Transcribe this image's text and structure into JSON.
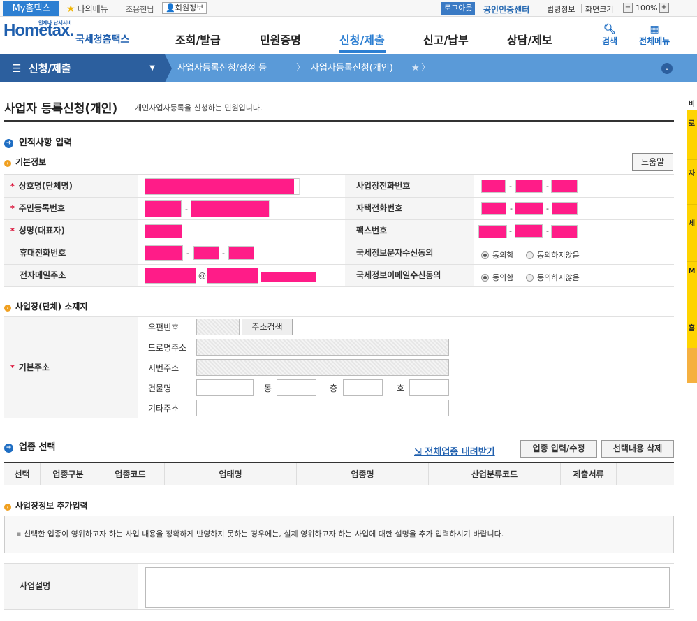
{
  "topbar": {
    "my_hometax": "My홈택스",
    "my_menu": "나의메뉴",
    "user_name": "조용현님",
    "member_info": "회원정보",
    "logout": "로그아웃",
    "cert_center": "공인인증센터",
    "law_info": "법령정보",
    "screen_size": "화면크기",
    "zoom": "100%"
  },
  "header": {
    "logo_text": "Hometax.",
    "logo_sub": "언제나 납세서비스",
    "logo_name": "국세청홈택스",
    "nav": [
      "조회/발급",
      "민원증명",
      "신청/제출",
      "신고/납부",
      "상담/제보"
    ],
    "active_nav": "신청/제출",
    "search": "검색",
    "all_menu": "전체메뉴"
  },
  "breadcrumb": {
    "main": "신청/제출",
    "item1": "사업자등록신청/정정 등",
    "item2": "사업자등록신청(개인)"
  },
  "page": {
    "title": "사업자 등록신청(개인)",
    "description": "개인사업자등록을 신청하는 민원입니다."
  },
  "personal": {
    "section_title": "인적사항 입력",
    "sub_title": "기본정보",
    "help_btn": "도움말",
    "rows": [
      {
        "label": "상호명(단체명)",
        "required": "*"
      },
      {
        "label": "주민등록번호",
        "required": "*"
      },
      {
        "label": "성명(대표자)",
        "required": "*"
      },
      {
        "label": "휴대전화번호",
        "required": ""
      },
      {
        "label": "전자메일주소",
        "required": ""
      }
    ],
    "right_rows": [
      {
        "label": "사업장전화번호"
      },
      {
        "label": "자택전화번호"
      },
      {
        "label": "팩스번호"
      },
      {
        "label": "국세정보문자수신동의",
        "agree": "동의함",
        "disagree": "동의하지않음"
      },
      {
        "label": "국세정보이메일수신동의",
        "agree": "동의함",
        "disagree": "동의하지않음"
      }
    ],
    "at": "@",
    "dash": "-"
  },
  "address": {
    "sub_title": "사업장(단체) 소재지",
    "label": "기본주소",
    "required": "*",
    "postcode": "우편번호",
    "search_btn": "주소검색",
    "road": "도로명주소",
    "jibun": "지번주소",
    "building": "건물명",
    "dong": "동",
    "floor": "층",
    "ho": "호",
    "etc": "기타주소"
  },
  "industry": {
    "section_title": "업종 선택",
    "download": "전체업종 내려받기",
    "input_btn": "업종 입력/수정",
    "delete_btn": "선택내용 삭제",
    "columns": [
      "선택",
      "업종구분",
      "업종코드",
      "업태명",
      "업종명",
      "산업분류코드",
      "제출서류"
    ]
  },
  "extra": {
    "sub_title": "사업장정보 추가입력",
    "notice": "선택한 업종이 영위하고자 하는 사업 내용을 정확하게 반영하지 못하는 경우에는, 실제 영위하고자 하는 사업에 대한 설명을 추가 입력하시기 바랍니다.",
    "desc_label": "사업설명"
  },
  "sidebar": {
    "tabs": [
      "비",
      "로",
      "자",
      "세",
      "M",
      "홈"
    ]
  },
  "colors": {
    "accent": "#2d7fd2",
    "navy": "#2c5f9e",
    "masked": "#ff1c88",
    "required": "#d9002a"
  }
}
